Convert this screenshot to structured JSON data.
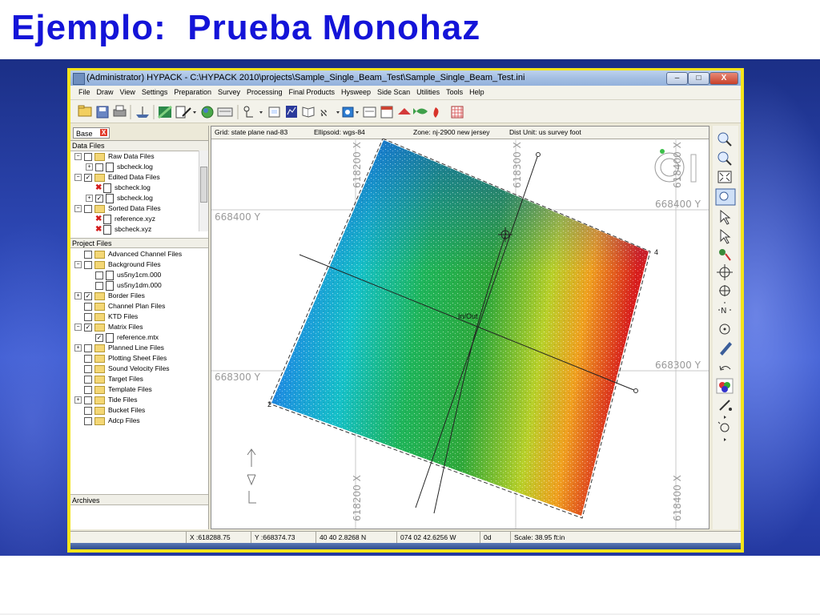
{
  "slide": {
    "title": "Ejemplo:  Prueba Monohaz"
  },
  "window": {
    "title": "(Administrator) HYPACK - C:\\HYPACK 2010\\projects\\Sample_Single_Beam_Test\\Sample_Single_Beam_Test.ini",
    "minimize": "–",
    "maximize": "□",
    "close": "X"
  },
  "menu": [
    "File",
    "Draw",
    "View",
    "Settings",
    "Preparation",
    "Survey",
    "Processing",
    "Final Products",
    "Hysweep",
    "Side Scan",
    "Utilities",
    "Tools",
    "Help"
  ],
  "left_panel": {
    "tab": "Base",
    "tab_close": "X",
    "data_files_header": "Data Files",
    "project_files_header": "Project Files",
    "archives": "Archives",
    "data_files": [
      {
        "label": "Raw Data Files",
        "type": "folder",
        "level": 0,
        "expander": "−",
        "check": ""
      },
      {
        "label": "sbcheck.log",
        "type": "doc",
        "level": 1,
        "expander": "+",
        "check": ""
      },
      {
        "label": "Edited Data Files",
        "type": "folder",
        "level": 0,
        "expander": "−",
        "check": "✓"
      },
      {
        "label": "sbcheck.log",
        "type": "doc",
        "level": 1,
        "expander": "",
        "check": "x"
      },
      {
        "label": "sbcheck.log",
        "type": "doc",
        "level": 1,
        "expander": "+",
        "check": "✓"
      },
      {
        "label": "Sorted Data Files",
        "type": "folder",
        "level": 0,
        "expander": "−",
        "check": ""
      },
      {
        "label": "reference.xyz",
        "type": "doc",
        "level": 1,
        "expander": "",
        "check": "x"
      },
      {
        "label": "sbcheck.xyz",
        "type": "doc",
        "level": 1,
        "expander": "",
        "check": "x"
      }
    ],
    "project_files": [
      {
        "label": "Advanced Channel Files",
        "type": "folder",
        "level": 0,
        "expander": "",
        "check": ""
      },
      {
        "label": "Background Files",
        "type": "folder",
        "level": 0,
        "expander": "−",
        "check": ""
      },
      {
        "label": "us5ny1cm.000",
        "type": "doc",
        "level": 1,
        "expander": "",
        "check": ""
      },
      {
        "label": "us5ny1dm.000",
        "type": "doc",
        "level": 1,
        "expander": "",
        "check": ""
      },
      {
        "label": "Border Files",
        "type": "folder",
        "level": 0,
        "expander": "+",
        "check": "✓"
      },
      {
        "label": "Channel Plan Files",
        "type": "folder",
        "level": 0,
        "expander": "",
        "check": ""
      },
      {
        "label": "KTD Files",
        "type": "folder",
        "level": 0,
        "expander": "",
        "check": ""
      },
      {
        "label": "Matrix Files",
        "type": "folder",
        "level": 0,
        "expander": "−",
        "check": "✓"
      },
      {
        "label": "reference.mtx",
        "type": "doc",
        "level": 1,
        "expander": "",
        "check": "✓"
      },
      {
        "label": "Planned Line Files",
        "type": "folder",
        "level": 0,
        "expander": "+",
        "check": ""
      },
      {
        "label": "Plotting Sheet Files",
        "type": "folder",
        "level": 0,
        "expander": "",
        "check": ""
      },
      {
        "label": "Sound Velocity Files",
        "type": "folder",
        "level": 0,
        "expander": "",
        "check": ""
      },
      {
        "label": "Target Files",
        "type": "folder",
        "level": 0,
        "expander": "",
        "check": ""
      },
      {
        "label": "Template Files",
        "type": "folder",
        "level": 0,
        "expander": "",
        "check": ""
      },
      {
        "label": "Tide Files",
        "type": "folder",
        "level": 0,
        "expander": "+",
        "check": ""
      },
      {
        "label": "Bucket Files",
        "type": "folder",
        "level": 0,
        "expander": "",
        "check": ""
      },
      {
        "label": "Adcp Files",
        "type": "folder",
        "level": 0,
        "expander": "",
        "check": ""
      }
    ]
  },
  "map": {
    "grid": "Grid: state plane nad-83",
    "ellipsoid": "Ellipsoid: wgs-84",
    "zone": "Zone: nj-2900 new jersey",
    "dist_unit": "Dist Unit: us survey foot",
    "y_label_top": "668400 Y",
    "y_label_bottom": "668300 Y",
    "x_label_left": "618200 X",
    "x_label_right": "618300 X",
    "x_label_far": "618400 X",
    "line_label": "In/Out",
    "corner_2": "2",
    "corner_4": "4",
    "colors": {
      "grid": "#bfbfbf",
      "label": "#9a9a9a"
    }
  },
  "status": {
    "x": "X :618288.75",
    "y": "Y :668374.73",
    "lat": "40 40 2.8268 N",
    "lon": "074 02 42.6256 W",
    "depth": "0d",
    "scale": "Scale: 38.95 ft:in"
  },
  "toolbar_icons": [
    "open-folder-icon",
    "save-icon",
    "print-icon",
    "boat-icon",
    "tools-icon",
    "chart-icon",
    "edit-icon",
    "globe-icon",
    "keyboard-icon",
    "tree-icon",
    "display-icon",
    "book-icon",
    "map-book-icon",
    "sound-icon",
    "export-icon",
    "calendar-icon",
    "boat-red-icon",
    "matrix-icon",
    "fish-icon",
    "grid-icon"
  ],
  "right_tools": [
    "zoom-in-icon",
    "zoom-out-icon",
    "zoom-extent-icon",
    "zoom-window-icon",
    "pointer-icon",
    "select-icon",
    "drag-icon",
    "crosshair-icon",
    "center-icon",
    "north-icon",
    "target-icon",
    "pen-icon",
    "undo-icon",
    "color-icon",
    "tool-a-icon",
    "tool-b-icon"
  ]
}
